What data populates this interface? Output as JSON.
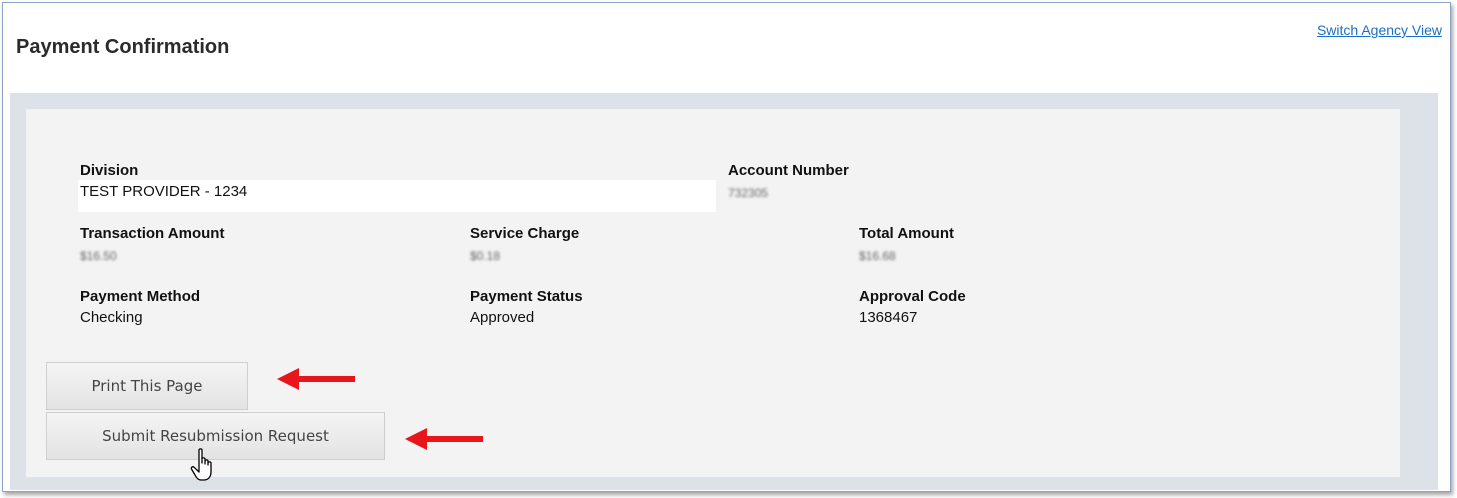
{
  "header": {
    "title": "Payment Confirmation",
    "switch_link": "Switch Agency View"
  },
  "fields": {
    "division": {
      "label": "Division",
      "value": "TEST PROVIDER - 1234"
    },
    "account_number": {
      "label": "Account Number",
      "value": "732305"
    },
    "transaction_amount": {
      "label": "Transaction Amount",
      "value": "$16.50"
    },
    "service_charge": {
      "label": "Service Charge",
      "value": "$0.18"
    },
    "total_amount": {
      "label": "Total Amount",
      "value": "$16.68"
    },
    "payment_method": {
      "label": "Payment Method",
      "value": "Checking"
    },
    "payment_status": {
      "label": "Payment Status",
      "value": "Approved"
    },
    "approval_code": {
      "label": "Approval Code",
      "value": "1368467"
    }
  },
  "buttons": {
    "print": "Print This Page",
    "resubmit": "Submit Resubmission Request"
  },
  "colors": {
    "link": "#1a6fc4",
    "annotation_arrow": "#e8161b",
    "panel_outer": "#dde2e8",
    "panel_inner": "#f3f3f3"
  },
  "icons": {
    "arrow": "red-arrow-left-icon",
    "cursor": "hand-pointer-icon"
  }
}
